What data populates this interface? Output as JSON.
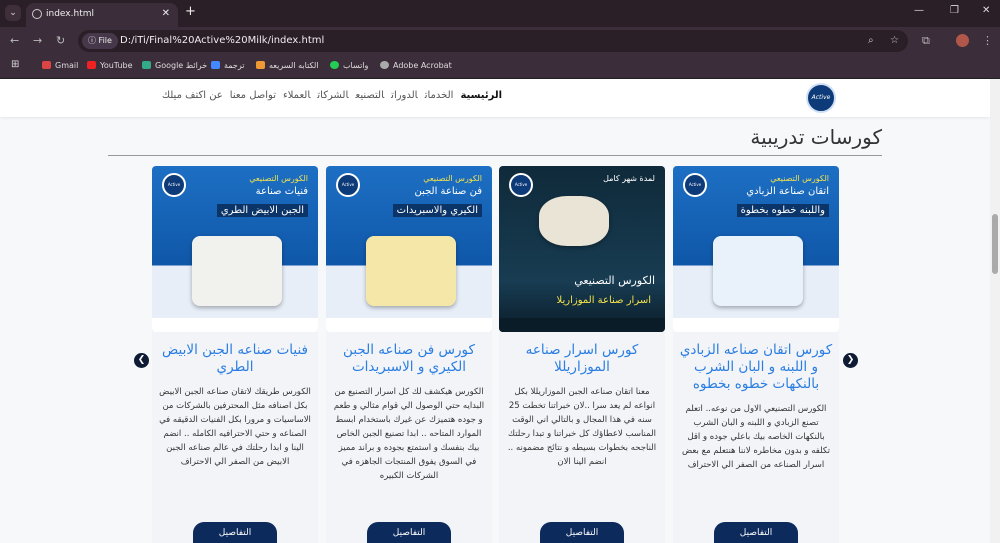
{
  "browser": {
    "tab_title": "index.html",
    "url": "D:/iTi/Final%20Active%20Milk/index.html",
    "file_chip": "File",
    "bookmarks": [
      "Gmail",
      "YouTube",
      "Google خرائط",
      "ترجمة",
      "الكتابه السريعه",
      "واتساب",
      "Adobe Acrobat"
    ]
  },
  "nav": {
    "logo": "Active",
    "items": [
      "الرئيسية",
      "الخدمات",
      "الدورات",
      "التصنيع",
      "الشركات",
      "العملاء",
      "تواصل معنا",
      "عن اكتف ميلك"
    ]
  },
  "section": {
    "heading": "كورسات تدريبية"
  },
  "cards": [
    {
      "img_t1": "الكورس التصنيعي",
      "img_t2": "اتقان صناعة الزبادي",
      "img_t3": "واللبنه خطوه بخطوة",
      "title": "كورس اتقان صناعه الزبادي و اللبنه و البان الشرب بالنكهات خطوه بخطوه",
      "desc": "الكورس التصنيعي الاول من نوعه.. اتعلم تصنع الزبادي و اللبنه و البان الشرب بالنكهات الخاصه بيك باعلي جوده و اقل تكلفه و بدون مخاطره لاننا هنتعلم مع بعض اسرار الصناعه من الصفر الي الاحتراف",
      "button": "التفاصيل"
    },
    {
      "img_t1": "لمدة شهر كامل",
      "img_t2": "الكورس التصنيعي",
      "img_t3": "اسرار صناعة الموزاريلا",
      "title": "كورس اسرار صناعه الموزاريللا",
      "desc": "معنا اتقان صناعه الجبن الموزاريللا بكل انواعه لم يعد سرا ..لان خبراتنا تخطت 25 سنه في هذا المجال و بالتالي اني الوقت المناسب لاعطاؤك كل خبراتنا و تبدا رحلتك الناجحه بخطوات بسيطه و نتائج مضمونه .. انضم الينا الان",
      "button": "التفاصيل"
    },
    {
      "img_t1": "الكورس التصنيعي",
      "img_t2": "فن صناعة الجبن",
      "img_t3": "الكيري والاسبريدات",
      "title": "كورس فن صناعه الجبن الكيري و الاسبريدات",
      "desc": "الكورس هيكشف لك كل اسرار التصنيع من البدايه حتي الوصول الي قوام مثالي و طعم و جوده هتميزك عن غيرك باستخدام ابسط الموارد المتاحه .. ابدا تصنيع الجبن الخاص بيك بنفسك و استمتع بجوده و براند مميز في السوق يفوق المنتجات الجاهزه في الشركات الكبيره",
      "button": "التفاصيل"
    },
    {
      "img_t1": "الكورس التصنيعي",
      "img_t2": "فنيات صناعة",
      "img_t3": "الجبن الابيض الطري",
      "title": "فنيات صناعه الجبن الابيض الطري",
      "desc": "الكورس طريقك لاتقان صناعه الجبن الابيض بكل اصنافه مثل المحترفين بالشركات من الاساسيات و مرورا بكل الفنيات الدقيقه في الصناعه و حتي الاحترافيه الكامله .. انضم الينا و ابدا رحلتك في عالم صناعه الجبن الابيض من الصفر الي الاحتراف",
      "button": "التفاصيل"
    }
  ]
}
